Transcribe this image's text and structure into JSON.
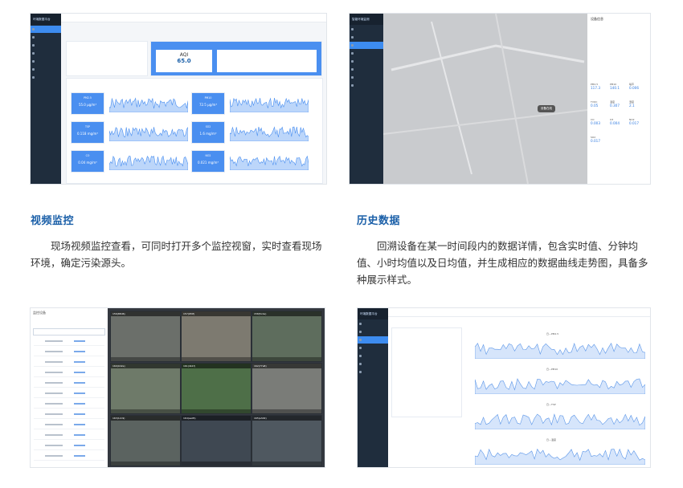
{
  "sections": [
    {
      "title": "视频监控",
      "description": "现场视频监控查看，可同时打开多个监控视窗，实时查看现场环境，确定污染源头。"
    },
    {
      "title": "历史数据",
      "description": "回溯设备在某一时间段内的数据详情，包含实时值、分钟均值、小时均值以及日均值，并生成相应的数据曲线走势图，具备多种展示样式。"
    }
  ],
  "screenshot1": {
    "app_title": "环境数据平台",
    "aqi_label": "AQI",
    "aqi_value": "65.0",
    "tiles": [
      {
        "name": "PM2.5",
        "value": "55.0 μg/m³"
      },
      {
        "name": "PM10",
        "value": "72.5 μg/m³"
      },
      {
        "name": "TSP",
        "value": "0.118 mg/m³"
      },
      {
        "name": "SO2",
        "value": "1.6 mg/m³"
      },
      {
        "name": "CO",
        "value": "0.04 mg/m³"
      },
      {
        "name": "NO2",
        "value": "0.021 mg/m³"
      }
    ]
  },
  "screenshot2": {
    "app_title": "智能环境监测",
    "panel_title": "设备信息",
    "readings": [
      {
        "label": "PM2.5",
        "value": "117.3"
      },
      {
        "label": "PM10",
        "value": "140.1"
      },
      {
        "label": "噪声",
        "value": "0.006"
      },
      {
        "label": "TVOC",
        "value": "0.05"
      },
      {
        "label": "温度",
        "value": "0.307"
      },
      {
        "label": "湿度",
        "value": "2.1"
      },
      {
        "label": "CO",
        "value": "0.003"
      },
      {
        "label": "O3",
        "value": "0.004"
      },
      {
        "label": "NO2",
        "value": "0.017"
      },
      {
        "label": "SO2",
        "value": "0.017"
      }
    ],
    "map_popup": "设备在线"
  },
  "screenshot3": {
    "panel_title": "监控设备",
    "cameras": [
      "156(88d6)",
      "157(9f4f)",
      "158(5c2a)",
      "160(0d2e)",
      "161(4b1f)",
      "162(77a8)",
      "163(12c9)",
      "164(ae05)",
      "165(e3d0)"
    ]
  },
  "screenshot4": {
    "app_title": "环境数据平台",
    "chart_titles": [
      "日—PM2.5",
      "日—PM10",
      "日—TSP",
      "日—温度"
    ]
  }
}
